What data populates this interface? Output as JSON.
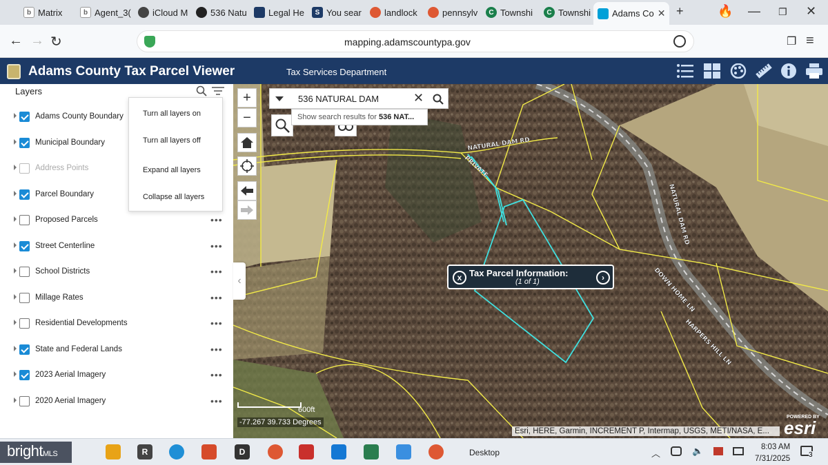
{
  "browser": {
    "tabs": [
      {
        "label": "Matrix",
        "icon": "b",
        "color": "#6a6a6a"
      },
      {
        "label": "Agent_3(",
        "icon": "b",
        "color": "#6a6a6a"
      },
      {
        "label": "iCloud M",
        "icon": "apple",
        "color": "#333333"
      },
      {
        "label": "536 Natu",
        "icon": "dog",
        "color": "#222222"
      },
      {
        "label": "Legal He",
        "icon": "shield",
        "color": "#1d3a66"
      },
      {
        "label": "You sear",
        "icon": "S",
        "color": "#1d3a66"
      },
      {
        "label": "landlock",
        "icon": "duck",
        "color": "#de5833"
      },
      {
        "label": "pennsylv",
        "icon": "duck",
        "color": "#de5833"
      },
      {
        "label": "Townshi",
        "icon": "C",
        "color": "#1a7f4b"
      },
      {
        "label": "Townshi",
        "icon": "C",
        "color": "#1a7f4b"
      },
      {
        "label": "Adams Co",
        "icon": "esri",
        "color": "#00a0d8",
        "active": true
      }
    ],
    "url": "mapping.adamscountypa.gov"
  },
  "app": {
    "title": "Adams County Tax Parcel Viewer",
    "subtitle": "Tax Services Department",
    "header_icons": [
      "list-icon",
      "grid-icon",
      "palette-icon",
      "ruler-icon",
      "info-icon",
      "print-icon"
    ]
  },
  "layers_panel": {
    "title": "Layers",
    "layers": [
      {
        "name": "Adams County Boundary",
        "checked": true,
        "dim": false,
        "menu": false
      },
      {
        "name": "Municipal Boundary",
        "checked": true,
        "dim": false,
        "menu": false
      },
      {
        "name": "Address Points",
        "checked": false,
        "dim": true,
        "menu": false
      },
      {
        "name": "Parcel Boundary",
        "checked": true,
        "dim": false,
        "menu": false
      },
      {
        "name": "Proposed Parcels",
        "checked": false,
        "dim": false,
        "menu": true
      },
      {
        "name": "Street Centerline",
        "checked": true,
        "dim": false,
        "menu": true
      },
      {
        "name": "School Districts",
        "checked": false,
        "dim": false,
        "menu": true
      },
      {
        "name": "Millage Rates",
        "checked": false,
        "dim": false,
        "menu": true
      },
      {
        "name": "Residential Developments",
        "checked": false,
        "dim": false,
        "menu": true
      },
      {
        "name": "State and Federal Lands",
        "checked": true,
        "dim": false,
        "menu": true
      },
      {
        "name": "2023 Aerial Imagery",
        "checked": true,
        "dim": false,
        "menu": true
      },
      {
        "name": "2020 Aerial Imagery",
        "checked": false,
        "dim": false,
        "menu": true
      }
    ],
    "menu": [
      "Turn all layers on",
      "Turn all layers off",
      "Expand all layers",
      "Collapse all layers"
    ]
  },
  "map": {
    "search_value": "536 NATURAL DAM",
    "suggest_prefix": "Show search results for ",
    "suggest_term": "536 NAT...",
    "popup_title": "Tax Parcel Information:",
    "popup_sub": "(1 of 1)",
    "scale_label": "600ft",
    "coords": "-77.267 39.733 Degrees",
    "attribution": "Esri, HERE, Garmin, INCREMENT P, Intermap, USGS, METI/NASA, E...",
    "powered_by": "POWERED BY",
    "esri_logo": "esri",
    "road_labels": [
      "NATURAL DAM RD",
      "PRIVATE",
      "NATURAL DAM RD",
      "DOWN HOME LN",
      "HARPERS HILL LN"
    ]
  },
  "taskbar": {
    "brand": "bright",
    "brand_suffix": "MLS",
    "desktop_label": "Desktop",
    "time": "8:03 AM",
    "date": "7/31/2025",
    "notif_count": "3"
  }
}
